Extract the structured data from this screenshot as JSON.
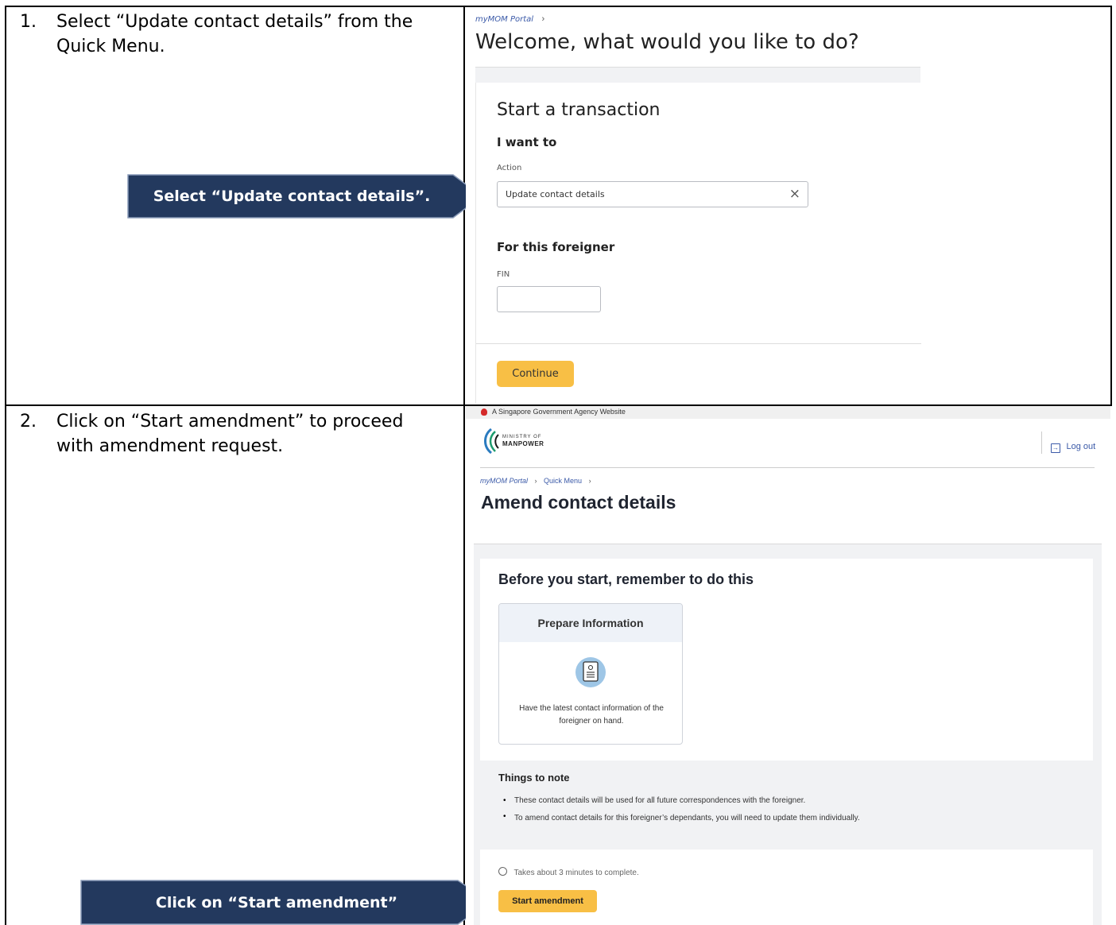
{
  "steps": [
    {
      "number": "1.",
      "text": "Select “Update contact details” from the Quick Menu."
    },
    {
      "number": "2.",
      "text": "Click on “Start amendment” to proceed with amendment request."
    }
  ],
  "callouts": {
    "select_update": "Select “Update contact details”.",
    "click_start": "Click on “Start amendment”"
  },
  "panel1": {
    "breadcrumb": "myMOM Portal",
    "title": "Welcome, what would you like to do?",
    "section_title": "Start a transaction",
    "i_want_to": "I want to",
    "action_label": "Action",
    "action_value": "Update contact details",
    "foreigner_heading": "For this foreigner",
    "fin_label": "FIN",
    "fin_value": "",
    "continue_label": "Continue"
  },
  "panel2": {
    "gov_banner": "A Singapore Government Agency Website",
    "logo_line1": "MINISTRY OF",
    "logo_line2": "MANPOWER",
    "logout": "Log out",
    "breadcrumb": [
      "myMOM Portal",
      "Quick Menu"
    ],
    "title": "Amend contact details",
    "before_heading": "Before you start, remember to do this",
    "card_title": "Prepare Information",
    "card_text": "Have the latest contact information of the foreigner on hand.",
    "things_heading": "Things to note",
    "notes": [
      "These contact details will be used for all future correspondences with the foreigner.",
      "To amend contact details for this foreigner’s dependants, you will need to update them individually."
    ],
    "duration": "Takes about 3 minutes to complete.",
    "start_label": "Start amendment"
  },
  "colors": {
    "callout_bg": "#23395e",
    "button_yellow": "#f8bf45",
    "link_blue": "#3b5aa8",
    "gov_red": "#d42a2a",
    "card_header": "#eef2f8"
  }
}
